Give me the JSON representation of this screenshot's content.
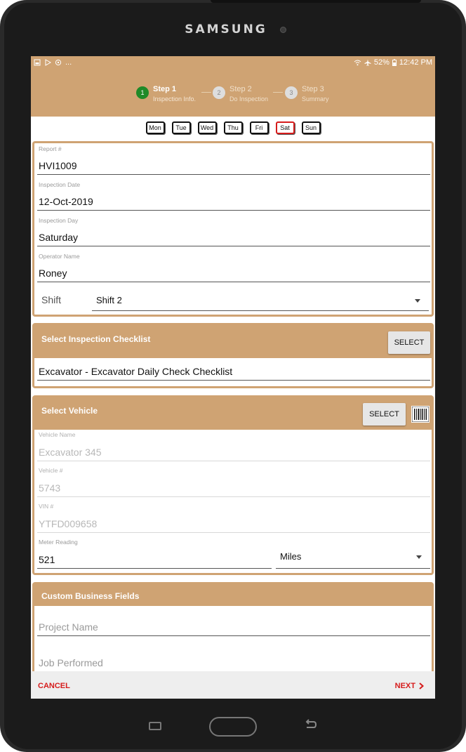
{
  "device": {
    "brand": "SAMSUNG"
  },
  "status_bar": {
    "left_icons": [
      "gallery-icon",
      "play-icon",
      "sync-icon"
    ],
    "left_more": "...",
    "battery": "52%",
    "time": "12:42 PM"
  },
  "stepper": {
    "steps": [
      {
        "number": "1",
        "title": "Step 1",
        "subtitle": "Inspection Info.",
        "state": "active"
      },
      {
        "number": "2",
        "title": "Step 2",
        "subtitle": "Do Inspection",
        "state": "inactive"
      },
      {
        "number": "3",
        "title": "Step 3",
        "subtitle": "Summary",
        "state": "inactive"
      }
    ],
    "active_color": "#1f8a28"
  },
  "days": {
    "items": [
      "Mon",
      "Tue",
      "Wed",
      "Thu",
      "Fri",
      "Sat",
      "Sun"
    ],
    "selected": "Sat",
    "selected_color": "#d61c1c"
  },
  "inspection_info": {
    "report_label": "Report #",
    "report_value": "HVI1009",
    "date_label": "Inspection Date",
    "date_value": "12-Oct-2019",
    "day_label": "Inspection Day",
    "day_value": "Saturday",
    "operator_label": "Operator Name",
    "operator_value": "Roney",
    "shift_label": "Shift",
    "shift_value": "Shift 2"
  },
  "checklist": {
    "header": "Select Inspection Checklist",
    "select_label": "SELECT",
    "value": "Excavator - Excavator Daily Check Checklist"
  },
  "vehicle": {
    "header": "Select Vehicle",
    "select_label": "SELECT",
    "barcode_icon": "barcode-icon",
    "name_label": "Vehicle Name",
    "name_value": "Excavator 345",
    "number_label": "Vehicle #",
    "number_value": "5743",
    "vin_label": "VIN #",
    "vin_value": "YTFD009658",
    "meter_label": "Meter Reading",
    "meter_value": "521",
    "unit_value": "Miles"
  },
  "custom_fields": {
    "header": "Custom Business Fields",
    "project_placeholder": "Project Name",
    "job_placeholder": "Job Performed"
  },
  "footer": {
    "cancel_label": "CANCEL",
    "next_label": "NEXT",
    "next_icon": "chevron-right-icon"
  },
  "theme": {
    "accent": "#cfa373",
    "danger": "#d61c1c"
  }
}
